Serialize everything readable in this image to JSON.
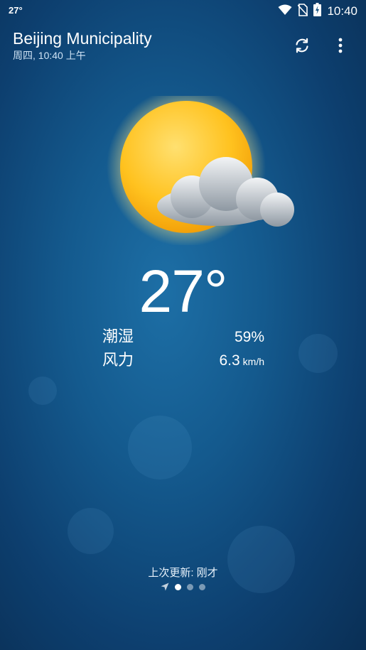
{
  "status_bar": {
    "temperature": "27°",
    "time": "10:40",
    "icons": [
      "wifi-icon",
      "no-sim-icon",
      "battery-charging-icon"
    ]
  },
  "header": {
    "city": "Beijing Municipality",
    "date_day": "周四,",
    "date_time": "10:40 上午",
    "actions": [
      "refresh-icon",
      "more-options-icon"
    ]
  },
  "current": {
    "condition_icon": "partly-sunny-icon",
    "temperature": "27°",
    "humidity_label": "潮湿",
    "humidity_value": "59%",
    "wind_label": "风力",
    "wind_value": "6.3",
    "wind_unit": "km/h"
  },
  "footer": {
    "last_updated": "上次更新: 刚才",
    "pages": {
      "location_icon": "location-arrow-icon",
      "count": 3,
      "active_index": 0
    }
  }
}
